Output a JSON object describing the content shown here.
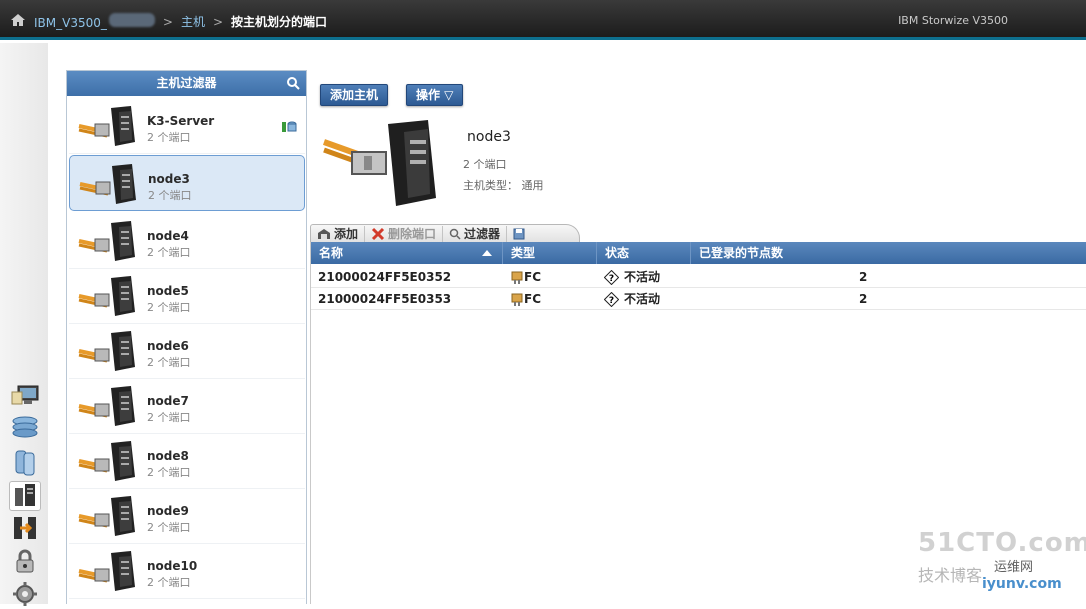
{
  "topbar": {
    "crumb_system": "IBM_V3500_",
    "crumb_hosts": "主机",
    "crumb_current": "按主机划分的端口",
    "product": "IBM Storwize V3500",
    "sep": ">"
  },
  "filter": {
    "title": "主机过滤器",
    "hosts": [
      {
        "name": "K3-Server",
        "ports": "2 个端口"
      },
      {
        "name": "node3",
        "ports": "2 个端口"
      },
      {
        "name": "node4",
        "ports": "2 个端口"
      },
      {
        "name": "node5",
        "ports": "2 个端口"
      },
      {
        "name": "node6",
        "ports": "2 个端口"
      },
      {
        "name": "node7",
        "ports": "2 个端口"
      },
      {
        "name": "node8",
        "ports": "2 个端口"
      },
      {
        "name": "node9",
        "ports": "2 个端口"
      },
      {
        "name": "node10",
        "ports": "2 个端口"
      }
    ]
  },
  "actions": {
    "add_host": "添加主机",
    "operations": "操作 ▽"
  },
  "detail": {
    "name": "node3",
    "ports": "2 个端口",
    "type": "主机类型： 通用"
  },
  "toolbar": {
    "add": "添加",
    "delete_port": "删除端口",
    "filter": "过滤器"
  },
  "table": {
    "headers": [
      "名称",
      "类型",
      "状态",
      "已登录的节点数"
    ],
    "rows": [
      {
        "name": "21000024FF5E0352",
        "type": "FC",
        "status": "不活动",
        "nodes": "2"
      },
      {
        "name": "21000024FF5E0353",
        "type": "FC",
        "status": "不活动",
        "nodes": "2"
      }
    ]
  },
  "watermark": {
    "line1": "51CTO.com",
    "line2": "技术博客",
    "line3": "运维网",
    "line4": "iyunv.com"
  }
}
